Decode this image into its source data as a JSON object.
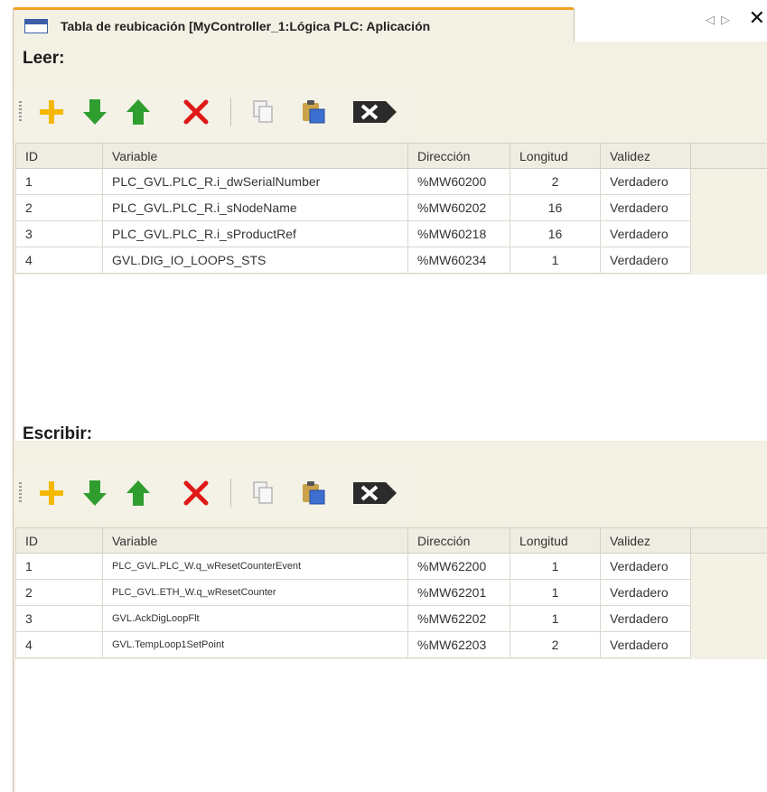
{
  "window": {
    "tab_title": "Tabla de reubicación [MyController_1:Lógica PLC: Aplicación",
    "nav_prev": "◁",
    "nav_next": "▷",
    "close": "✕"
  },
  "read_section": {
    "label": "Leer:",
    "toolbar": [
      "add",
      "move-down",
      "move-up",
      "delete",
      "copy",
      "paste",
      "clear"
    ],
    "columns": [
      "ID",
      "Variable",
      "Dirección",
      "Longitud",
      "Validez"
    ],
    "rows": [
      {
        "id": "1",
        "variable": "PLC_GVL.PLC_R.i_dwSerialNumber",
        "address": "%MW60200",
        "length": "2",
        "validity": "Verdadero"
      },
      {
        "id": "2",
        "variable": "PLC_GVL.PLC_R.i_sNodeName",
        "address": "%MW60202",
        "length": "16",
        "validity": "Verdadero"
      },
      {
        "id": "3",
        "variable": "PLC_GVL.PLC_R.i_sProductRef",
        "address": "%MW60218",
        "length": "16",
        "validity": "Verdadero"
      },
      {
        "id": "4",
        "variable": "GVL.DIG_IO_LOOPS_STS",
        "address": "%MW60234",
        "length": "1",
        "validity": "Verdadero"
      }
    ]
  },
  "write_section": {
    "label": "Escribir:",
    "toolbar": [
      "add",
      "move-down",
      "move-up",
      "delete",
      "copy",
      "paste",
      "clear"
    ],
    "columns": [
      "ID",
      "Variable",
      "Dirección",
      "Longitud",
      "Validez"
    ],
    "rows": [
      {
        "id": "1",
        "variable": "PLC_GVL.PLC_W.q_wResetCounterEvent",
        "address": "%MW62200",
        "length": "1",
        "validity": "Verdadero"
      },
      {
        "id": "2",
        "variable": "PLC_GVL.ETH_W.q_wResetCounter",
        "address": "%MW62201",
        "length": "1",
        "validity": "Verdadero"
      },
      {
        "id": "3",
        "variable": "GVL.AckDigLoopFlt",
        "address": "%MW62202",
        "length": "1",
        "validity": "Verdadero"
      },
      {
        "id": "4",
        "variable": "GVL.TempLoop1SetPoint",
        "address": "%MW62203",
        "length": "2",
        "validity": "Verdadero"
      }
    ]
  },
  "colors": {
    "panel_bg": "#f3f0e4",
    "tab_accent": "#f0a020",
    "add": "#f5b800",
    "arrows": "#2f9e2f",
    "delete": "#e01818"
  }
}
